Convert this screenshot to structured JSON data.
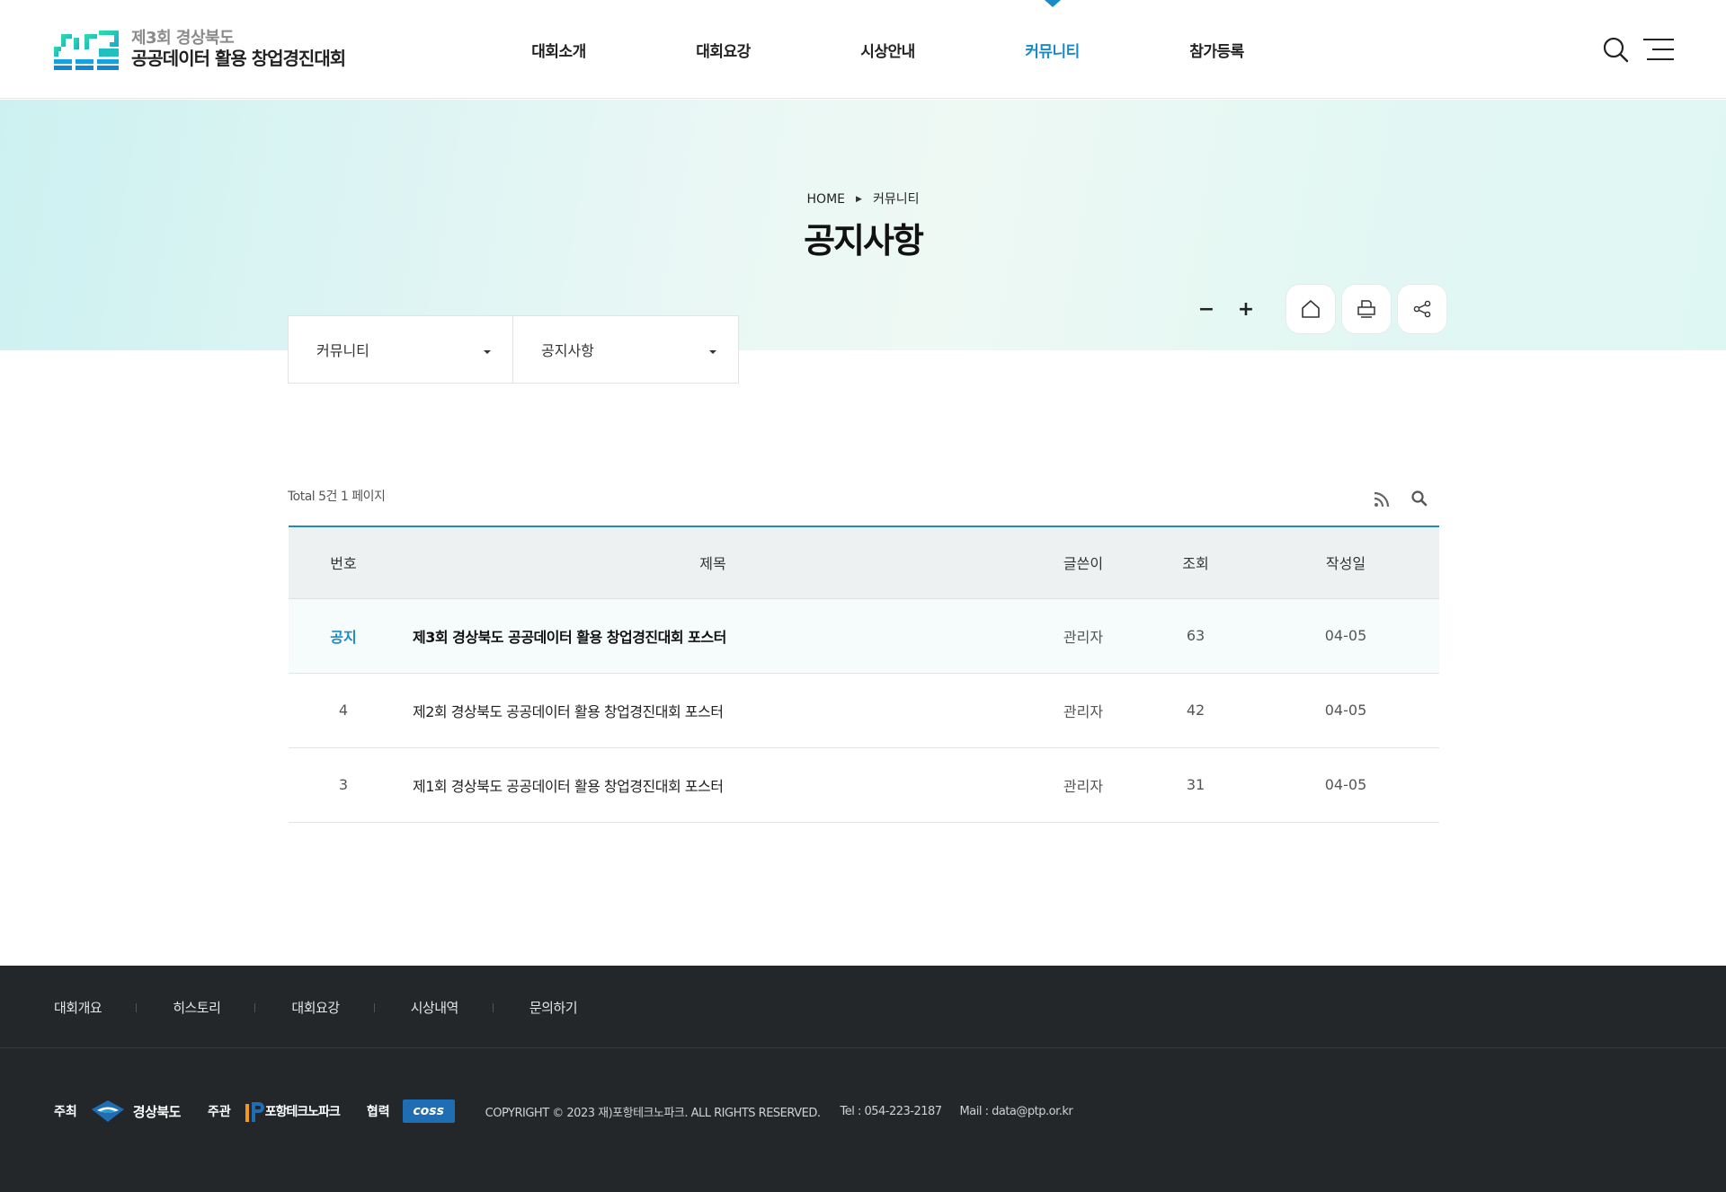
{
  "header": {
    "logo_line1": "제3회 경상북도",
    "logo_line2": "공공데이터 활용 창업경진대회",
    "nav": [
      {
        "label": "대회소개"
      },
      {
        "label": "대회요강"
      },
      {
        "label": "시상안내"
      },
      {
        "label": "커뮤니티",
        "active": true
      },
      {
        "label": "참가등록"
      }
    ],
    "search_icon": "search-icon",
    "menu_icon": "hamburger-menu-icon"
  },
  "visual": {
    "breadcrumb_home": "HOME",
    "breadcrumb_current": "커뮤니티",
    "page_title": "공지사항",
    "font_decrease": "−",
    "font_increase": "+",
    "icons": [
      "home-icon",
      "print-icon",
      "share-icon"
    ]
  },
  "subnav": {
    "depth1": "커뮤니티",
    "depth2": "공지사항"
  },
  "board": {
    "total_text": "Total 5건 1 페이지",
    "columns": [
      "번호",
      "제목",
      "글쓴이",
      "조회",
      "작성일"
    ],
    "rows": [
      {
        "num": "공지",
        "subject": "제3회 경상북도 공공데이터 활용 창업경진대회 포스터",
        "writer": "관리자",
        "views": "63",
        "date": "04-05"
      },
      {
        "num": "4",
        "subject": "제2회 경상북도 공공데이터 활용 창업경진대회 포스터",
        "writer": "관리자",
        "views": "42",
        "date": "04-05"
      },
      {
        "num": "3",
        "subject": "제1회 경상북도 공공데이터 활용 창업경진대회 포스터",
        "writer": "관리자",
        "views": "31",
        "date": "04-05"
      }
    ]
  },
  "footer": {
    "nav": [
      "대회개요",
      "히스토리",
      "대회요강",
      "시상내역",
      "문의하기"
    ],
    "host_label": "주최",
    "host_name": "경상북도",
    "organizer_label": "주관",
    "organizer_name": "포항테크노파크",
    "partner_label": "협력",
    "partner_name": "coss",
    "copyright": "COPYRIGHT © 2023 재)포항테크노파크. ALL RIGHTS RESERVED.",
    "tel": "Tel : 054-223-2187",
    "mail": "Mail : data@ptp.or.kr"
  },
  "colors": {
    "accent": "#1a8bc7",
    "logo_green": "#1dd39a",
    "logo_blue": "#1aa0e0",
    "footer_bg": "#23272a"
  }
}
